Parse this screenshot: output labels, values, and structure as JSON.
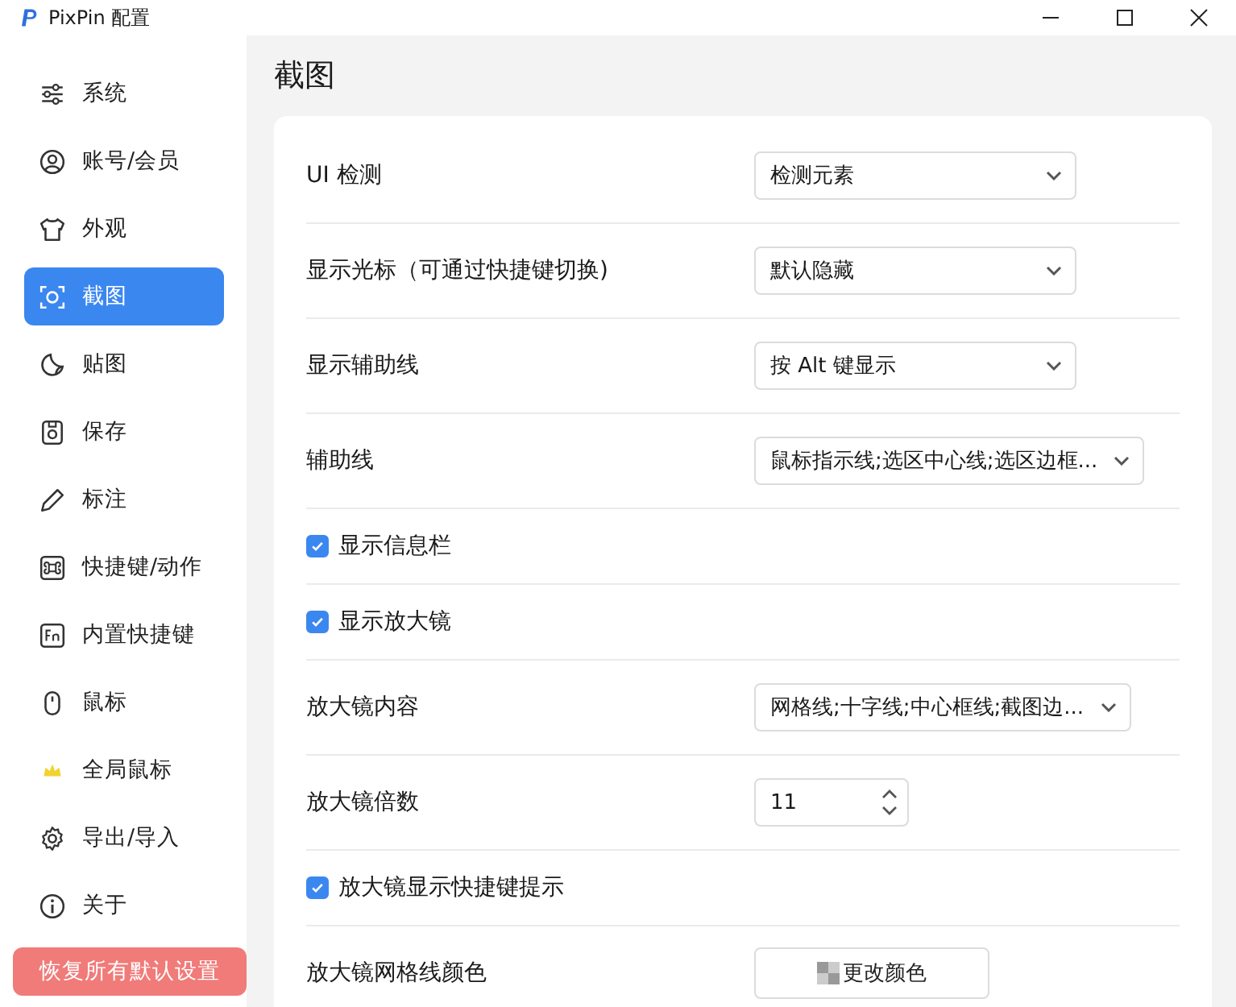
{
  "window": {
    "title": "PixPin 配置"
  },
  "sidebar": {
    "items": [
      {
        "label": "系统",
        "selected": false
      },
      {
        "label": "账号/会员",
        "selected": false
      },
      {
        "label": "外观",
        "selected": false
      },
      {
        "label": "截图",
        "selected": true
      },
      {
        "label": "贴图",
        "selected": false
      },
      {
        "label": "保存",
        "selected": false
      },
      {
        "label": "标注",
        "selected": false
      },
      {
        "label": "快捷键/动作",
        "selected": false
      },
      {
        "label": "内置快捷键",
        "selected": false
      },
      {
        "label": "鼠标",
        "selected": false
      },
      {
        "label": "全局鼠标",
        "selected": false
      },
      {
        "label": "导出/导入",
        "selected": false
      },
      {
        "label": "关于",
        "selected": false
      }
    ],
    "reset_button": "恢复所有默认设置"
  },
  "page": {
    "title": "截图",
    "settings": [
      {
        "kind": "select",
        "label": "UI 检测",
        "value": "检测元素"
      },
      {
        "kind": "select",
        "label": "显示光标（可通过快捷键切换)",
        "value": "默认隐藏"
      },
      {
        "kind": "select",
        "label": "显示辅助线",
        "value": "按 Alt 键显示"
      },
      {
        "kind": "select",
        "label": "辅助线",
        "value": "鼠标指示线;选区中心线;选区边框..."
      },
      {
        "kind": "checkbox",
        "label": "显示信息栏",
        "checked": true
      },
      {
        "kind": "checkbox",
        "label": "显示放大镜",
        "checked": true
      },
      {
        "kind": "select",
        "label": "放大镜内容",
        "value": "网格线;十字线;中心框线;截图边..."
      },
      {
        "kind": "number",
        "label": "放大镜倍数",
        "value": "11"
      },
      {
        "kind": "checkbox",
        "label": "放大镜显示快捷键提示",
        "checked": true
      },
      {
        "kind": "color",
        "label": "放大镜网格线颜色",
        "value": "更改颜色"
      }
    ]
  }
}
